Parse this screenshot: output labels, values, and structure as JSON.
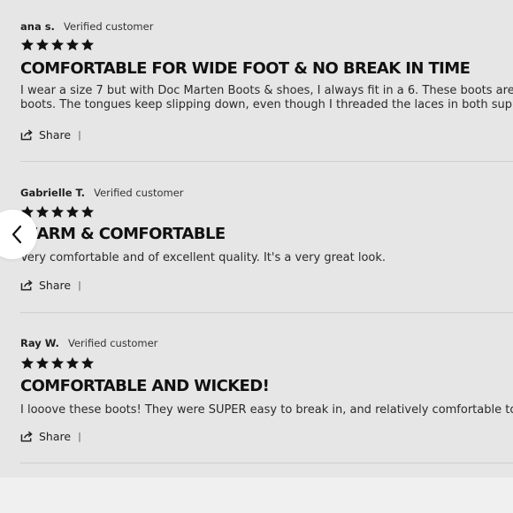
{
  "reviews": [
    {
      "author": "ana s.",
      "verified": "Verified customer",
      "rating": 5,
      "title": "COMFORTABLE FOR WIDE FOOT & NO BREAK IN TIME",
      "body_line1": "I wear a size 7 but with Doc Marten Boots & shoes, I always fit in a 6. These boots are s",
      "body_line2": "boots. The tongues keep slipping down, even though I threaded the laces in both supp",
      "share_label": "Share",
      "separator": "|"
    },
    {
      "author": "Gabrielle T.",
      "verified": "Verified customer",
      "rating": 5,
      "title": "WARM & COMFORTABLE",
      "body_line1": "Very comfortable and of excellent quality. It's a very great look.",
      "share_label": "Share",
      "separator": "|"
    },
    {
      "author": "Ray W.",
      "verified": "Verified customer",
      "rating": 5,
      "title": "COMFORTABLE AND WICKED!",
      "body_line1": "I looove these boots! They were SUPER easy to break in, and relatively comfortable to w",
      "share_label": "Share",
      "separator": "|"
    }
  ],
  "icons": {
    "star": "star-icon",
    "share": "share-icon",
    "previous": "chevron-left-icon"
  },
  "colors": {
    "background": "#e6e6e6",
    "star": "#111111",
    "divider": "#cfcfcf",
    "button": "#ffffff"
  }
}
